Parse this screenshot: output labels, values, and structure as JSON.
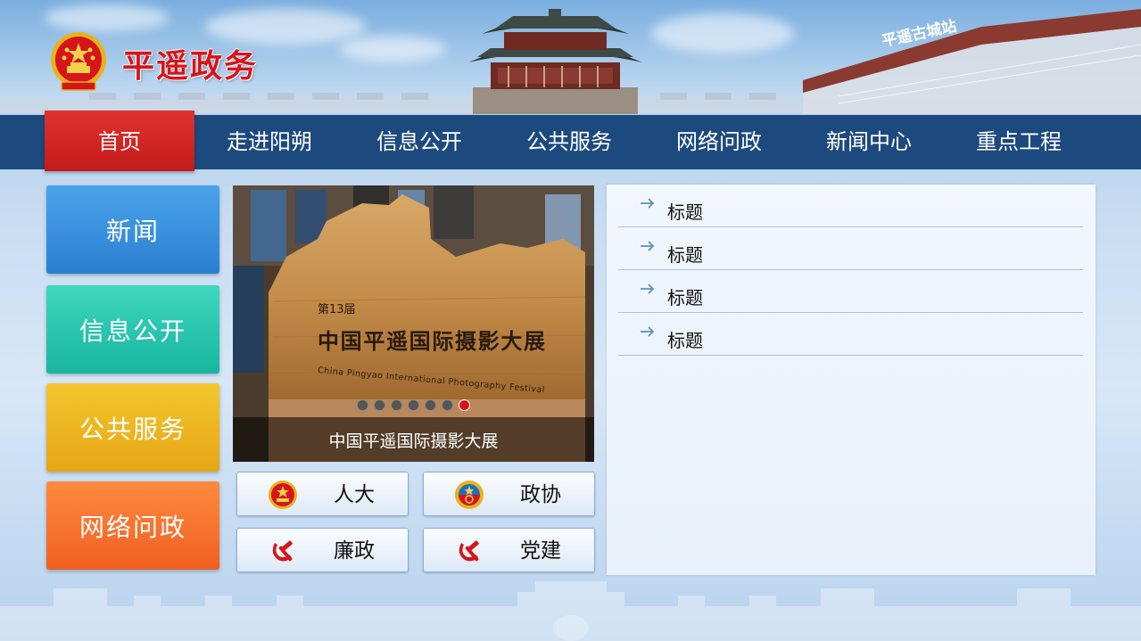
{
  "header": {
    "site_title": "平遥政务",
    "station_sign": "平遥古城站"
  },
  "nav": {
    "items": [
      {
        "label": "首页",
        "active": true
      },
      {
        "label": "走进阳朔",
        "active": false
      },
      {
        "label": "信息公开",
        "active": false
      },
      {
        "label": "公共服务",
        "active": false
      },
      {
        "label": "网络问政",
        "active": false
      },
      {
        "label": "新闻中心",
        "active": false
      },
      {
        "label": "重点工程",
        "active": false
      }
    ]
  },
  "tiles": {
    "news": "新闻",
    "info": "信息公开",
    "service": "公共服务",
    "inquiry": "网络问政"
  },
  "carousel": {
    "caption": "中国平遥国际摄影大展",
    "sign_top": "第13届",
    "sign_main": "中国平遥国际摄影大展",
    "sign_en": "China Pingyao International Photography Festival",
    "dot_count": 7,
    "active_dot": 6
  },
  "quick_links": {
    "renda": "人大",
    "zhengxie": "政协",
    "lianzheng": "廉政",
    "dangjian": "党建"
  },
  "news": {
    "items": [
      "标题",
      "标题",
      "标题",
      "标题"
    ]
  },
  "colors": {
    "nav_bg": "#1d4a7e",
    "nav_active": "#d42622",
    "title_red": "#d6151b",
    "tile_news": "#2b7fd2",
    "tile_info": "#17b59f",
    "tile_service": "#e6a615",
    "tile_inquiry": "#f05f22"
  }
}
